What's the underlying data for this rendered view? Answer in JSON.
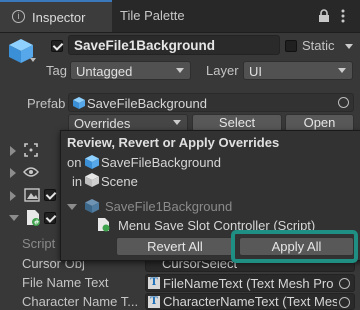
{
  "tabs": [
    {
      "label": "Inspector",
      "active": true
    },
    {
      "label": "Tile Palette",
      "active": false
    }
  ],
  "header_icons": [
    "lock-icon",
    "kebab-menu-icon"
  ],
  "object": {
    "name": "SaveFile1Background",
    "active": true,
    "static_label": "Static",
    "static_checked": false,
    "tag_label": "Tag",
    "tag_value": "Untagged",
    "layer_label": "Layer",
    "layer_value": "UI"
  },
  "prefab": {
    "label": "Prefab",
    "asset": "SaveFileBackground",
    "overrides_label": "Overrides",
    "select_label": "Select",
    "open_label": "Open"
  },
  "popup": {
    "title": "Review, Revert or Apply Overrides",
    "on_prefix": "on",
    "on_asset": "SaveFileBackground",
    "in_prefix": "in",
    "in_asset": "Scene",
    "tree_root": "SaveFile1Background",
    "tree_child": "Menu Save Slot Controller (Script)",
    "revert_label": "Revert All",
    "apply_label": "Apply All"
  },
  "properties": [
    {
      "label": "Script",
      "value": ""
    },
    {
      "label": "Cursor Obj",
      "value": "CursorSelect"
    },
    {
      "label": "File Name Text",
      "value": "FileNameText (Text Mesh Pro U"
    },
    {
      "label": "Character Name T...",
      "value": "CharacterNameText (Text Mes"
    }
  ],
  "colors": {
    "highlight": "#1f8f84",
    "accent": "#3a79bb"
  }
}
